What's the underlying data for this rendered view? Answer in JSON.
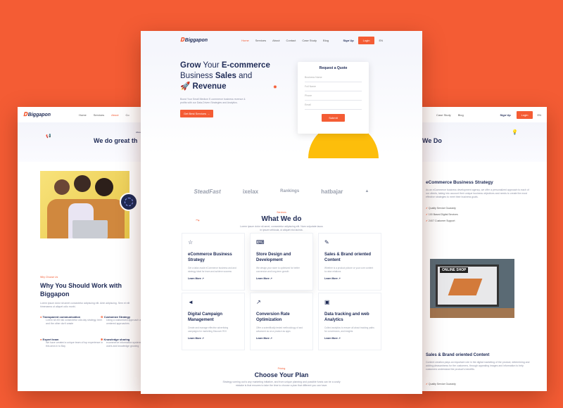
{
  "left_page": {
    "logo": "Biggapon",
    "nav": [
      "Home",
      "Services",
      "About",
      "Co"
    ],
    "nav_active": "About",
    "eyebrow": "Abou",
    "heading": "We do great th",
    "badge_text": "",
    "why_eyebrow": "Why Choose Us",
    "why_title": "Why You Should Work with Biggapon",
    "why_desc": "Lorem ipsum dolor sit amet consectetur adipiscing elit. Ante adipiscing. Sem et elit himenaeos ut aliquet odio morbi.",
    "features": [
      {
        "title": "Transparent communication",
        "desc": "Lorem sit elit nisi consectetur ulla day strategy, term and the other don't waste"
      },
      {
        "title": "Customize Strategy",
        "desc": "Using a customized approach are client-centered approaches"
      },
      {
        "title": "Expert team",
        "desc": "We have created a unique team of top experience in this area in to Bay"
      },
      {
        "title": "Knowledge sharing",
        "desc": "ecommerce information systems for users and knowledge growing"
      }
    ]
  },
  "right_page": {
    "nav": [
      "Case Study",
      "Blog"
    ],
    "sign_up": "Sign Up",
    "login": "Login",
    "lang": "EN",
    "heading": "We Do",
    "strategy_title": "eCommerce Business Strategy",
    "strategy_desc": "As an eCommerce business development agency, we offer a personalized approach to each of our clients, taking into account their unique business objectives and needs to create the most effective strategies to meet their business goals.",
    "checks": [
      "Quality Service Guaranty",
      "100 Based Digital Services",
      "24X7 Customer Support"
    ],
    "shop_sign": "ONLINE SHOP",
    "content_title": "Sales & Brand oriented Content",
    "content_desc": "Content creation plays an important role in the digital marketing of the product, determining and adding pleasantness for the customers, through appealing images and information to help customers understand the product's benefits.",
    "checks2": [
      "Quality Service Guaranty"
    ]
  },
  "center_page": {
    "logo": "Biggapon",
    "nav": [
      "Home",
      "Services",
      "About",
      "Contact",
      "Case Study",
      "Blog"
    ],
    "nav_active": "Home",
    "sign_up": "Sign Up",
    "login": "Login",
    "lang": "EN",
    "hero": {
      "l1a": "Grow",
      "l1b": " Your ",
      "l1c": "E-commerce",
      "l2a": "Business ",
      "l2b": "Sales",
      "l2c": " and",
      "l3": "Revenue",
      "desc": "Boost Your Small Medium E-commerce business revenue & profits with our Data-Driven Strategies and Analytics.",
      "cta": "Get Best Services →"
    },
    "quote": {
      "title": "Request a Quote",
      "fields": [
        "Business Name",
        "Full Name",
        "Phone",
        "Email"
      ],
      "submit": "Submit"
    },
    "brands": [
      "SteadFast",
      "ixelax",
      "Rankings",
      "hatbajar",
      "brand"
    ],
    "what": {
      "eyebrow": "Services",
      "title": "What We do",
      "desc": "Lorem ipsum dolor sit amet, consectetur adipiscing elit. Nam vulputate lacus in ipsum vehicula, ut aliquet nisi lacinia."
    },
    "services": [
      {
        "icon": "bulb-icon",
        "title": "eCommerce Business Strategy",
        "desc": "Get a tailor-made eCommerce business and and strategy ideal for learn and achieve success",
        "more": "Learn More ↗"
      },
      {
        "icon": "code-icon",
        "title": "Store Design and Development",
        "desc": "We design your store to optimized for better conversion and long-term growth",
        "more": "Learn More ↗"
      },
      {
        "icon": "pen-icon",
        "title": "Sales & Brand oriented Content",
        "desc": "Whether is a product picture or your core content to raise relations",
        "more": "Learn More ↗"
      },
      {
        "icon": "megaphone-icon",
        "title": "Digital Campaign Management",
        "desc": "Create and manage effective advertising campaigns for marketing Discover ROI",
        "more": "Learn More ↗"
      },
      {
        "icon": "chart-icon",
        "title": "Conversion Rate Optimization",
        "desc": "Offer a scientifically tested methodology of and advanced as an a product as apps",
        "more": "Learn More ↗"
      },
      {
        "icon": "analytics-icon",
        "title": "Data tracking and web Analytics",
        "desc": "Collect analytics to ensure all about tracking paths for conversions, and insights",
        "more": "Learn More ↗"
      }
    ],
    "plan": {
      "eyebrow": "Pricing",
      "title": "Choose Your Plan",
      "desc": "Strategy coming out is any marketing initiative, and from unique planning and possible funds can be a costly mistake is that ensures to take the time to choose a plan that different you can have."
    }
  }
}
